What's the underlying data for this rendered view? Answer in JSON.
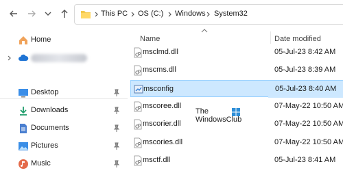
{
  "breadcrumb": [
    "This PC",
    "OS (C:)",
    "Windows",
    "System32"
  ],
  "columns": {
    "name": "Name",
    "date": "Date modified"
  },
  "sidebar": {
    "home": "Home",
    "onedrive_label": "",
    "items": [
      {
        "label": "Desktop",
        "icon": "desktop-icon"
      },
      {
        "label": "Downloads",
        "icon": "download-icon"
      },
      {
        "label": "Documents",
        "icon": "documents-icon"
      },
      {
        "label": "Pictures",
        "icon": "pictures-icon"
      },
      {
        "label": "Music",
        "icon": "music-icon"
      }
    ]
  },
  "files": [
    {
      "name": "msclmd.dll",
      "date": "05-Jul-23 8:42 AM",
      "selected": false
    },
    {
      "name": "mscms.dll",
      "date": "05-Jul-23 8:39 AM",
      "selected": false
    },
    {
      "name": "msconfig",
      "date": "05-Jul-23 8:40 AM",
      "selected": true
    },
    {
      "name": "mscoree.dll",
      "date": "07-May-22 10:50 AM",
      "selected": false
    },
    {
      "name": "mscorier.dll",
      "date": "07-May-22 10:50 AM",
      "selected": false
    },
    {
      "name": "mscories.dll",
      "date": "07-May-22 10:50 AM",
      "selected": false
    },
    {
      "name": "msctf.dll",
      "date": "05-Jul-23 8:41 AM",
      "selected": false
    }
  ],
  "watermark": {
    "line1": "The",
    "line2": "WindowsClub"
  },
  "colors": {
    "selection": "#cde8ff",
    "selection_border": "#99d1ff",
    "folder": "#f3c84b"
  }
}
